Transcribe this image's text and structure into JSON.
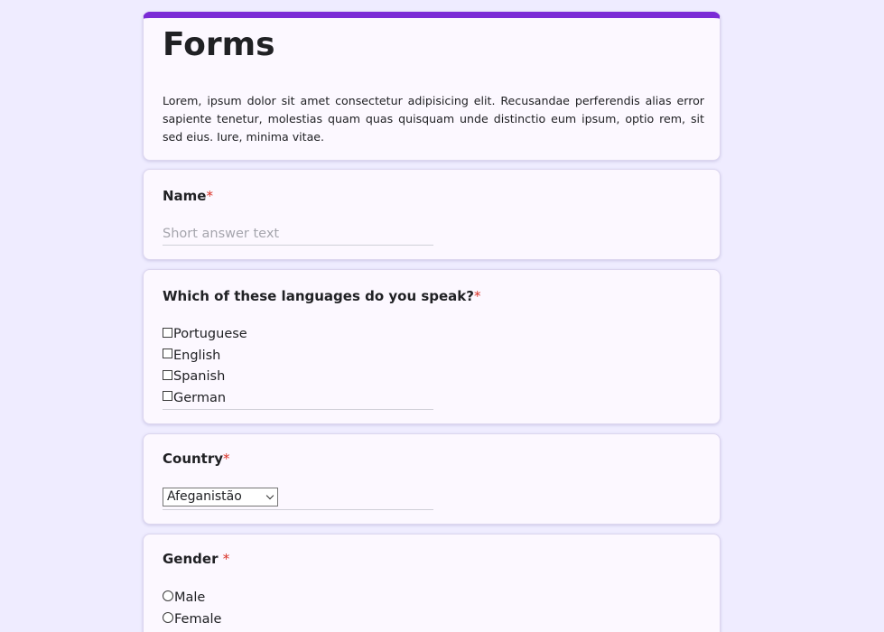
{
  "form": {
    "title": "Forms",
    "description": "Lorem, ipsum dolor sit amet consectetur adipisicing elit. Recusandae perferendis alias error sapiente tenetur, molestias quam quas quisquam unde distinctio eum ipsum, optio rem, sit sed eius. Iure, minima vitae."
  },
  "required_mark": "*",
  "name_q": {
    "label": "Name",
    "placeholder": "Short answer text"
  },
  "languages_q": {
    "label": "Which of these languages do you speak?",
    "options": [
      "Portuguese",
      "English",
      "Spanish",
      "German"
    ]
  },
  "country_q": {
    "label": "Country",
    "selected": "Afeganistão"
  },
  "gender_q": {
    "label": "Gender ",
    "options": [
      "Male",
      "Female"
    ]
  },
  "colors": {
    "accent": "#7b2bd6",
    "background": "#efecff",
    "card": "#fcf8ff",
    "required": "#d93025"
  }
}
